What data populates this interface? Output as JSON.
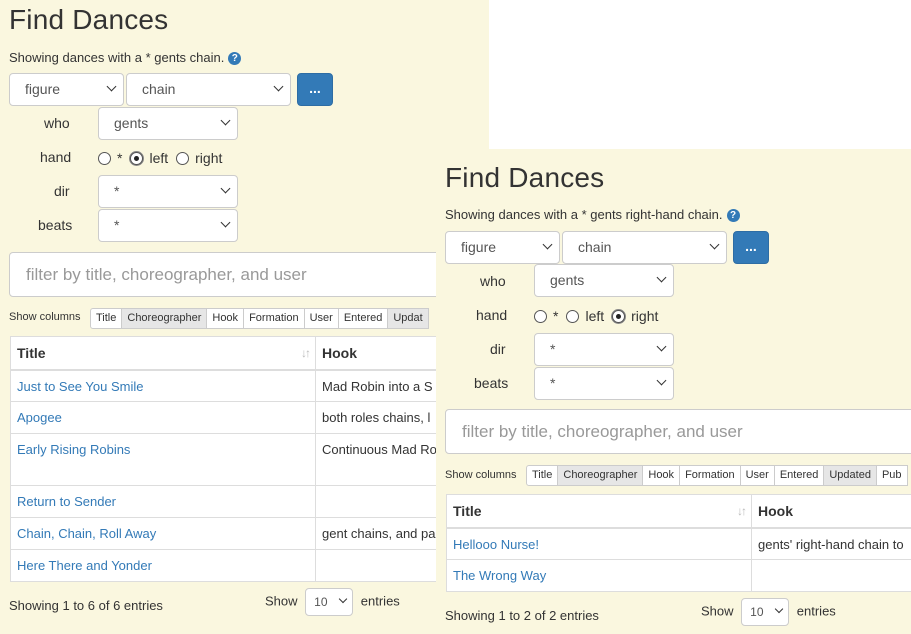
{
  "panels": [
    {
      "title": "Find Dances",
      "summary": "Showing dances with a * gents chain.",
      "figure_select": "figure",
      "figure_value_select": "chain",
      "more_button": "...",
      "fields": {
        "who_label": "who",
        "who_value": "gents",
        "hand_label": "hand",
        "hand_options": [
          "*",
          "left",
          "right"
        ],
        "hand_selected": "left",
        "dir_label": "dir",
        "dir_value": "*",
        "beats_label": "beats",
        "beats_value": "*"
      },
      "filter_placeholder": "filter by title, choreographer, and user",
      "show_columns_label": "Show columns",
      "column_toggles": [
        "Title",
        "Choreographer",
        "Hook",
        "Formation",
        "User",
        "Entered",
        "Updat"
      ],
      "column_toggles_active": [
        "Choreographer",
        "Updat"
      ],
      "table": {
        "headers": [
          "Title",
          "Hook"
        ],
        "rows": [
          {
            "title": "Just to See You Smile",
            "hook": "Mad Robin into a S"
          },
          {
            "title": "Apogee",
            "hook": "both roles chains, l"
          },
          {
            "title": "Early Rising Robins",
            "hook": "Continuous Mad Ro"
          },
          {
            "title": "Return to Sender",
            "hook": ""
          },
          {
            "title": "Chain, Chain, Roll Away",
            "hook": "gent chains, and pa"
          },
          {
            "title": "Here There and Yonder",
            "hook": ""
          }
        ]
      },
      "info": "Showing 1 to 6 of 6 entries",
      "length_show": "Show",
      "length_value": "10",
      "length_entries": "entries"
    },
    {
      "title": "Find Dances",
      "summary": "Showing dances with a * gents right-hand chain.",
      "figure_select": "figure",
      "figure_value_select": "chain",
      "more_button": "...",
      "fields": {
        "who_label": "who",
        "who_value": "gents",
        "hand_label": "hand",
        "hand_options": [
          "*",
          "left",
          "right"
        ],
        "hand_selected": "right",
        "dir_label": "dir",
        "dir_value": "*",
        "beats_label": "beats",
        "beats_value": "*"
      },
      "filter_placeholder": "filter by title, choreographer, and user",
      "show_columns_label": "Show columns",
      "column_toggles": [
        "Title",
        "Choreographer",
        "Hook",
        "Formation",
        "User",
        "Entered",
        "Updated",
        "Pub"
      ],
      "column_toggles_active": [
        "Choreographer",
        "Updated"
      ],
      "table": {
        "headers": [
          "Title",
          "Hook"
        ],
        "rows": [
          {
            "title": "Hellooo Nurse!",
            "hook": "gents' right-hand chain to"
          },
          {
            "title": "The Wrong Way",
            "hook": ""
          }
        ]
      },
      "info": "Showing 1 to 2 of 2 entries",
      "length_show": "Show",
      "length_value": "10",
      "length_entries": "entries"
    }
  ]
}
